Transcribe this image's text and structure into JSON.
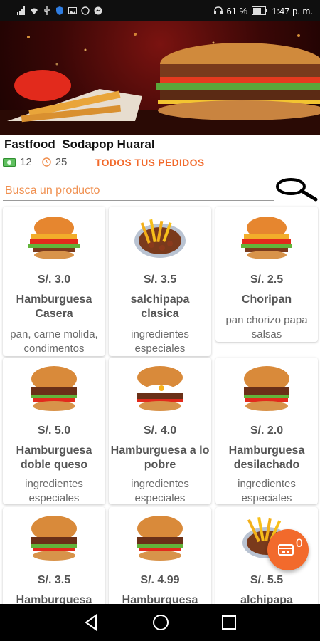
{
  "status_bar": {
    "battery": "61 %",
    "time": "1:47 p. m."
  },
  "store": {
    "name": "Fastfood  Sodapop Huaral",
    "count_a": "12",
    "count_b": "25",
    "orders_link": "TODOS TUS PEDIDOS"
  },
  "search": {
    "placeholder": "Busca un producto"
  },
  "products": [
    {
      "price": "S/. 3.0",
      "name": "Hamburguesa Casera",
      "desc": "pan, carne molida, condimentos"
    },
    {
      "price": "S/. 3.5",
      "name": "salchipapa clasica",
      "desc": "ingredientes especiales"
    },
    {
      "price": "S/. 2.5",
      "name": "Choripan",
      "desc": "pan chorizo papa salsas"
    },
    {
      "price": "S/. 5.0",
      "name": "Hamburguesa doble queso",
      "desc": "ingredientes especiales"
    },
    {
      "price": "S/. 4.0",
      "name": "Hamburguesa a lo pobre",
      "desc": "ingredientes especiales"
    },
    {
      "price": "S/. 2.0",
      "name": "Hamburguesa desilachado",
      "desc": "ingredientes especiales"
    },
    {
      "price": "S/. 3.5",
      "name": "Hamburguesa",
      "desc": ""
    },
    {
      "price": "S/. 4.99",
      "name": "Hamburguesa",
      "desc": ""
    },
    {
      "price": "S/. 5.5",
      "name": "alchipapa",
      "desc": ""
    }
  ],
  "cart": {
    "count": "0"
  },
  "colors": {
    "accent": "#f26a2c",
    "status_bar": "#0f0f0f",
    "nav_bar": "#000000"
  },
  "icons": {
    "status_left": [
      "signal-icon",
      "wifi-icon",
      "usb-icon",
      "shield-icon",
      "image-icon",
      "whatsapp-icon",
      "messenger-icon"
    ],
    "status_right": [
      "headphones-icon",
      "battery-icon"
    ],
    "meta": [
      "money-icon",
      "clock-icon"
    ],
    "search": "search-icon",
    "cart": "cart-icon",
    "nav": [
      "back-icon",
      "home-icon",
      "recents-icon"
    ]
  }
}
